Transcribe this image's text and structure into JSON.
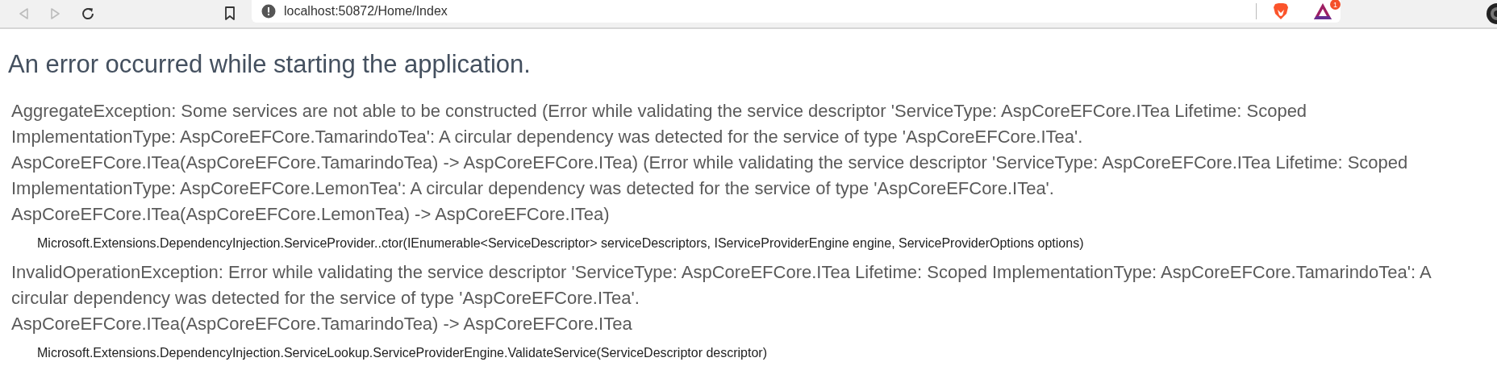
{
  "browser": {
    "url": "localhost:50872/Home/Index",
    "back_disabled": true,
    "forward_disabled": true,
    "badge": "1"
  },
  "title": "An error occurred while starting the application.",
  "errors": [
    {
      "lines": [
        "AggregateException: Some services are not able to be constructed (Error while validating the service descriptor 'ServiceType: AspCoreEFCore.ITea Lifetime: Scoped",
        "ImplementationType: AspCoreEFCore.TamarindoTea': A circular dependency was detected for the service of type 'AspCoreEFCore.ITea'.",
        "AspCoreEFCore.ITea(AspCoreEFCore.TamarindoTea) -> AspCoreEFCore.ITea) (Error while validating the service descriptor 'ServiceType: AspCoreEFCore.ITea Lifetime: Scoped",
        "ImplementationType: AspCoreEFCore.LemonTea': A circular dependency was detected for the service of type 'AspCoreEFCore.ITea'.",
        "AspCoreEFCore.ITea(AspCoreEFCore.LemonTea) -> AspCoreEFCore.ITea)"
      ],
      "location": "Microsoft.Extensions.DependencyInjection.ServiceProvider..ctor(IEnumerable<ServiceDescriptor> serviceDescriptors, IServiceProviderEngine engine, ServiceProviderOptions options)"
    },
    {
      "lines": [
        "InvalidOperationException: Error while validating the service descriptor 'ServiceType: AspCoreEFCore.ITea Lifetime: Scoped ImplementationType: AspCoreEFCore.TamarindoTea': A",
        "circular dependency was detected for the service of type 'AspCoreEFCore.ITea'.",
        "AspCoreEFCore.ITea(AspCoreEFCore.TamarindoTea) -> AspCoreEFCore.ITea"
      ],
      "location": "Microsoft.Extensions.DependencyInjection.ServiceLookup.ServiceProviderEngine.ValidateService(ServiceDescriptor descriptor)"
    }
  ]
}
